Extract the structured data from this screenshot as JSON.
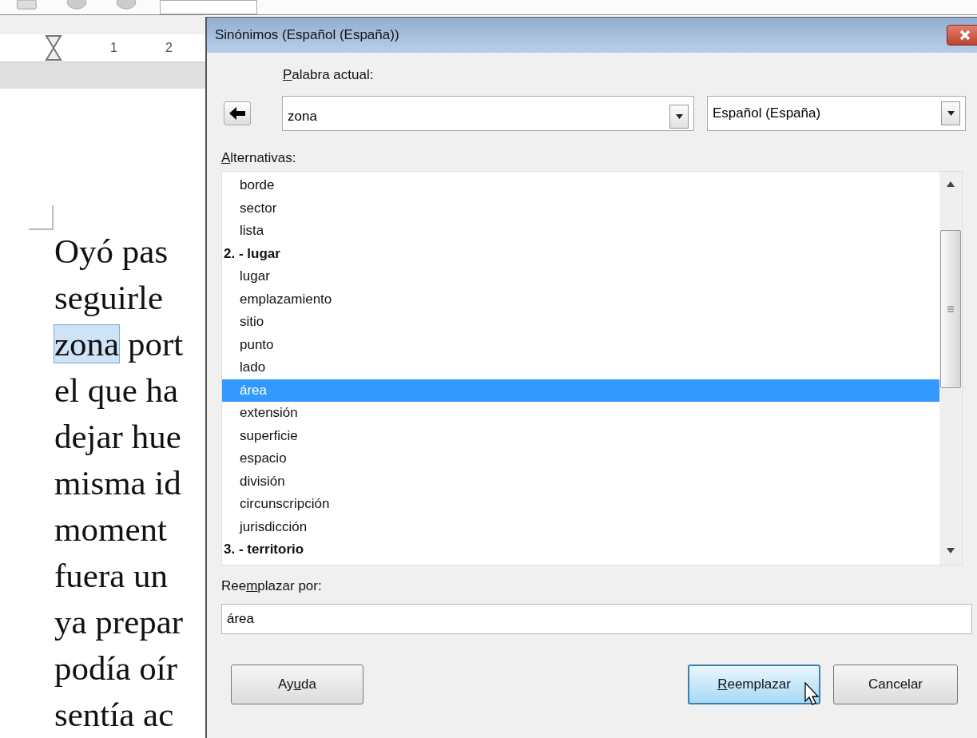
{
  "ruler": {
    "labels": [
      "1",
      "2"
    ]
  },
  "document": {
    "lines": [
      {
        "text": "Oyó pas"
      },
      {
        "text": "seguirle"
      },
      {
        "text": "zona",
        "highlighted": true,
        "rest": " port"
      },
      {
        "text": "el que ha"
      },
      {
        "text": "dejar hue"
      },
      {
        "text": "misma id"
      },
      {
        "text": "moment"
      },
      {
        "text": "fuera un"
      },
      {
        "text": "ya prepar"
      },
      {
        "text": "podía oír"
      },
      {
        "text": "sentía ac"
      }
    ]
  },
  "dialog": {
    "title": "Sinónimos (Español (España))",
    "current_word": {
      "label_key": "P",
      "label_rest": "alabra actual:",
      "value": "zona"
    },
    "language": {
      "value": "Español (España)"
    },
    "alternatives": {
      "label_key": "A",
      "label_rest": "lternativas:",
      "items": [
        {
          "kind": "word",
          "text": "borde",
          "selected": false
        },
        {
          "kind": "word",
          "text": "sector",
          "selected": false
        },
        {
          "kind": "word",
          "text": "lista",
          "selected": false
        },
        {
          "kind": "heading",
          "text": "2. - lugar",
          "selected": false
        },
        {
          "kind": "word",
          "text": "lugar",
          "selected": false
        },
        {
          "kind": "word",
          "text": "emplazamiento",
          "selected": false
        },
        {
          "kind": "word",
          "text": "sitio",
          "selected": false
        },
        {
          "kind": "word",
          "text": "punto",
          "selected": false
        },
        {
          "kind": "word",
          "text": "lado",
          "selected": false
        },
        {
          "kind": "word",
          "text": "área",
          "selected": true
        },
        {
          "kind": "word",
          "text": "extensión",
          "selected": false
        },
        {
          "kind": "word",
          "text": "superficie",
          "selected": false
        },
        {
          "kind": "word",
          "text": "espacio",
          "selected": false
        },
        {
          "kind": "word",
          "text": "división",
          "selected": false
        },
        {
          "kind": "word",
          "text": "circunscripción",
          "selected": false
        },
        {
          "kind": "word",
          "text": "jurisdicción",
          "selected": false
        },
        {
          "kind": "heading",
          "text": "3. - territorio",
          "selected": false
        }
      ]
    },
    "replace": {
      "label_start": "Ree",
      "label_key": "m",
      "label_rest": "plazar por:",
      "value": "área"
    },
    "buttons": [
      {
        "label_start": "Ay",
        "label_key": "u",
        "label_rest": "da",
        "kind": "help"
      },
      {
        "label_key": "R",
        "label_rest": "eemplazar",
        "kind": "default"
      },
      {
        "label_rest": "Cancelar",
        "kind": "cancel"
      }
    ]
  }
}
